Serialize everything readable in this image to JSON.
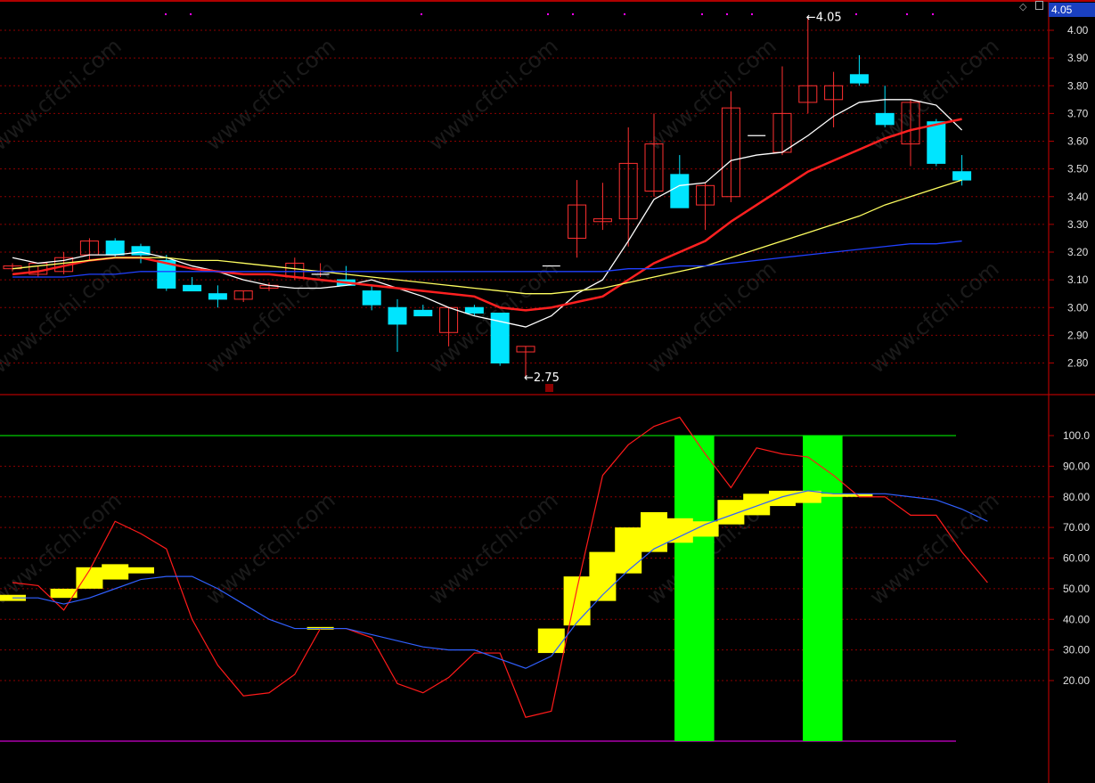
{
  "header": {
    "last_price_tag": "4.05",
    "icons": [
      "diamond-icon",
      "panel-icon"
    ]
  },
  "watermark_text": "www.cfchi.com",
  "colors": {
    "up": "#ff3030",
    "down": "#00e5ff",
    "ma5": "#ffffff",
    "ma10": "#ff2020",
    "ma20": "#ffff60",
    "ma60": "#2040ff",
    "grid": "#8b0000",
    "osc_fast": "#ff1a1a",
    "osc_slow": "#3060ff",
    "osc_block": "#ffff00",
    "osc_signal": "#00ff00",
    "level_high": "#00cc00",
    "level_low": "#cc00cc"
  },
  "chart_data": [
    {
      "type": "candlestick",
      "name": "price",
      "ylim": [
        2.7,
        4.08
      ],
      "yticks": [
        "2.80",
        "2.90",
        "3.00",
        "3.10",
        "3.20",
        "3.30",
        "3.40",
        "3.50",
        "3.60",
        "3.70",
        "3.80",
        "3.90",
        "4.00"
      ],
      "annotations": [
        {
          "text": "4.05",
          "index": 31,
          "value": 4.05
        },
        {
          "text": "2.75",
          "index": 20,
          "value": 2.75
        }
      ],
      "candles": [
        [
          3.14,
          3.16,
          3.13,
          3.15
        ],
        [
          3.12,
          3.15,
          3.11,
          3.16
        ],
        [
          3.13,
          3.2,
          3.12,
          3.18
        ],
        [
          3.19,
          3.25,
          3.17,
          3.24
        ],
        [
          3.24,
          3.25,
          3.18,
          3.19
        ],
        [
          3.22,
          3.23,
          3.16,
          3.19
        ],
        [
          3.17,
          3.19,
          3.06,
          3.07
        ],
        [
          3.08,
          3.11,
          3.06,
          3.06
        ],
        [
          3.05,
          3.08,
          3.0,
          3.03
        ],
        [
          3.03,
          3.06,
          3.02,
          3.06
        ],
        [
          3.07,
          3.09,
          3.06,
          3.08
        ],
        [
          3.11,
          3.18,
          3.1,
          3.16
        ],
        [
          3.12,
          3.16,
          3.11,
          3.12
        ],
        [
          3.1,
          3.15,
          3.08,
          3.08
        ],
        [
          3.06,
          3.08,
          2.99,
          3.01
        ],
        [
          3.0,
          3.03,
          2.84,
          2.94
        ],
        [
          2.99,
          3.01,
          2.97,
          2.97
        ],
        [
          2.91,
          3.0,
          2.86,
          3.0
        ],
        [
          3.0,
          3.01,
          2.97,
          2.98
        ],
        [
          2.98,
          2.98,
          2.79,
          2.8
        ],
        [
          2.84,
          2.86,
          2.75,
          2.86
        ],
        [
          3.15,
          3.15,
          3.15,
          3.15
        ],
        [
          3.25,
          3.46,
          3.18,
          3.37
        ],
        [
          3.31,
          3.45,
          3.28,
          3.32
        ],
        [
          3.32,
          3.65,
          3.22,
          3.52
        ],
        [
          3.42,
          3.7,
          3.4,
          3.59
        ],
        [
          3.48,
          3.55,
          3.36,
          3.36
        ],
        [
          3.37,
          3.45,
          3.28,
          3.44
        ],
        [
          3.4,
          3.78,
          3.38,
          3.72
        ],
        [
          3.62,
          3.62,
          3.62,
          3.62
        ],
        [
          3.56,
          3.87,
          3.55,
          3.7
        ],
        [
          3.74,
          4.05,
          3.7,
          3.8
        ],
        [
          3.75,
          3.85,
          3.65,
          3.8
        ],
        [
          3.84,
          3.91,
          3.8,
          3.81
        ],
        [
          3.7,
          3.8,
          3.65,
          3.66
        ],
        [
          3.59,
          3.75,
          3.51,
          3.74
        ],
        [
          3.67,
          3.68,
          3.51,
          3.52
        ],
        [
          3.49,
          3.55,
          3.44,
          3.46
        ]
      ],
      "series": [
        {
          "key": "ma5",
          "values": [
            3.18,
            3.16,
            3.17,
            3.19,
            3.19,
            3.2,
            3.18,
            3.15,
            3.13,
            3.1,
            3.08,
            3.07,
            3.07,
            3.08,
            3.1,
            3.07,
            3.04,
            3.0,
            2.97,
            2.95,
            2.93,
            2.97,
            3.05,
            3.1,
            3.24,
            3.39,
            3.44,
            3.45,
            3.53,
            3.55,
            3.56,
            3.62,
            3.69,
            3.74,
            3.75,
            3.75,
            3.73,
            3.64
          ]
        },
        {
          "key": "ma10",
          "values": [
            3.12,
            3.13,
            3.15,
            3.17,
            3.18,
            3.18,
            3.16,
            3.14,
            3.13,
            3.12,
            3.12,
            3.11,
            3.1,
            3.09,
            3.08,
            3.07,
            3.06,
            3.05,
            3.04,
            3.0,
            2.99,
            3.0,
            3.02,
            3.04,
            3.1,
            3.16,
            3.2,
            3.24,
            3.31,
            3.37,
            3.43,
            3.49,
            3.53,
            3.57,
            3.61,
            3.64,
            3.66,
            3.68
          ]
        },
        {
          "key": "ma20",
          "values": [
            3.14,
            3.15,
            3.16,
            3.17,
            3.18,
            3.18,
            3.18,
            3.17,
            3.17,
            3.16,
            3.15,
            3.14,
            3.13,
            3.12,
            3.11,
            3.1,
            3.09,
            3.08,
            3.07,
            3.06,
            3.05,
            3.05,
            3.06,
            3.07,
            3.09,
            3.11,
            3.13,
            3.15,
            3.18,
            3.21,
            3.24,
            3.27,
            3.3,
            3.33,
            3.37,
            3.4,
            3.43,
            3.46
          ]
        },
        {
          "key": "ma60",
          "values": [
            3.11,
            3.11,
            3.11,
            3.12,
            3.12,
            3.13,
            3.13,
            3.13,
            3.13,
            3.13,
            3.13,
            3.13,
            3.13,
            3.13,
            3.13,
            3.13,
            3.13,
            3.13,
            3.13,
            3.13,
            3.13,
            3.13,
            3.13,
            3.13,
            3.14,
            3.14,
            3.15,
            3.15,
            3.16,
            3.17,
            3.18,
            3.19,
            3.2,
            3.21,
            3.22,
            3.23,
            3.23,
            3.24
          ]
        }
      ]
    },
    {
      "type": "oscillator",
      "name": "indicator",
      "ylim": [
        0,
        110
      ],
      "yticks": [
        "20.00",
        "30.00",
        "40.00",
        "50.00",
        "60.00",
        "70.00",
        "80.00",
        "90.00",
        "100.0"
      ],
      "levels": [
        {
          "key": "level_high",
          "value": 100
        },
        {
          "key": "level_low",
          "value": 0
        }
      ],
      "fast": [
        52,
        51,
        43,
        56,
        72,
        68,
        63,
        40,
        25,
        15,
        16,
        22,
        37,
        37,
        34,
        19,
        16,
        21,
        29,
        29,
        8,
        10,
        50,
        87,
        97,
        103,
        106,
        94,
        83,
        96,
        94,
        93,
        87,
        80,
        80,
        74,
        74,
        62,
        52
      ],
      "slow": [
        47,
        47,
        45,
        47,
        50,
        53,
        54,
        54,
        50,
        45,
        40,
        37,
        37,
        37,
        35,
        33,
        31,
        30,
        30,
        27,
        24,
        28,
        39,
        48,
        56,
        63,
        67,
        71,
        74,
        77,
        80,
        82,
        81,
        81,
        81,
        80,
        79,
        76,
        72
      ],
      "blocks": [
        {
          "index": 0,
          "from": 46,
          "to": 48
        },
        {
          "index": 2,
          "from": 47,
          "to": 50
        },
        {
          "index": 3,
          "from": 50,
          "to": 57
        },
        {
          "index": 4,
          "from": 53,
          "to": 58
        },
        {
          "index": 5,
          "from": 55,
          "to": 57
        },
        {
          "index": 12,
          "from": 37,
          "to": 37.5
        },
        {
          "index": 21,
          "from": 29,
          "to": 37
        },
        {
          "index": 22,
          "from": 38,
          "to": 54
        },
        {
          "index": 23,
          "from": 46,
          "to": 62
        },
        {
          "index": 24,
          "from": 55,
          "to": 70
        },
        {
          "index": 25,
          "from": 62,
          "to": 75
        },
        {
          "index": 26,
          "from": 65,
          "to": 73
        },
        {
          "index": 27,
          "from": 67,
          "to": 72
        },
        {
          "index": 28,
          "from": 71,
          "to": 79
        },
        {
          "index": 29,
          "from": 74,
          "to": 81
        },
        {
          "index": 30,
          "from": 77,
          "to": 82
        },
        {
          "index": 31,
          "from": 78,
          "to": 82
        },
        {
          "index": 32,
          "from": 80,
          "to": 81
        },
        {
          "index": 33,
          "from": 80,
          "to": 81
        }
      ],
      "signals": [
        {
          "start_index": 25.8,
          "end_index": 27.0
        },
        {
          "start_index": 30.8,
          "end_index": 32.0
        }
      ]
    }
  ]
}
